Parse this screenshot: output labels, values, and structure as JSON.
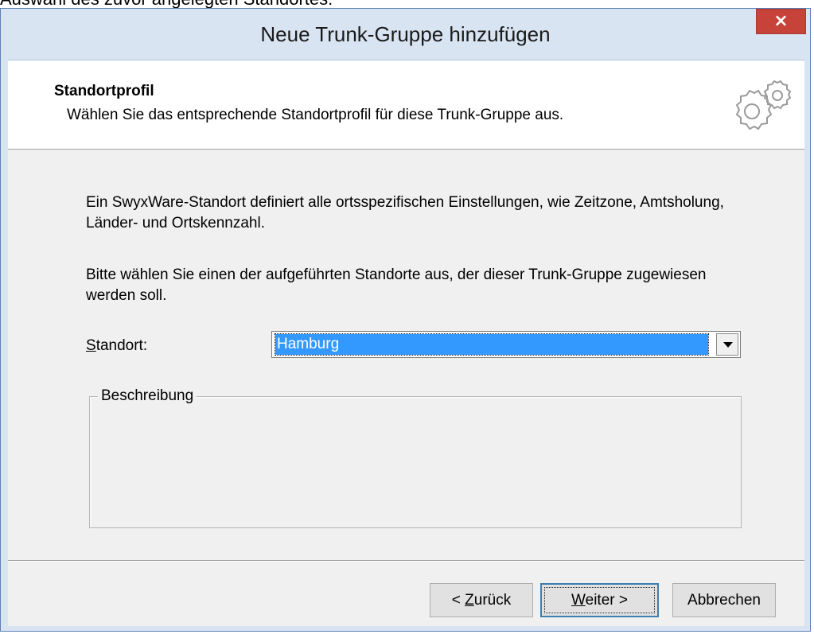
{
  "caption": "Auswahl des zuvor angelegten Standortes:",
  "window": {
    "title": "Neue Trunk-Gruppe hinzufügen",
    "close_glyph": "×"
  },
  "header": {
    "title": "Standortprofil",
    "subtitle": "Wählen Sie das entsprechende Standortprofil für diese Trunk-Gruppe aus.",
    "icon": "gears-icon"
  },
  "content": {
    "paragraph1": "Ein SwyxWare-Standort definiert alle ortsspezifischen Einstellungen, wie Zeitzone, Amtsholung, Länder- und Ortskennzahl.",
    "paragraph2": "Bitte wählen Sie einen der aufgeführten Standorte aus, der dieser Trunk-Gruppe zugewiesen werden soll.",
    "standort_label_mnemonic": "S",
    "standort_label_rest": "tandort:",
    "standort_value": "Hamburg",
    "description_legend": "Beschreibung"
  },
  "buttons": {
    "back_prefix": "< ",
    "back_mnemonic": "Z",
    "back_rest": "urück",
    "next_mnemonic": "W",
    "next_rest": "eiter >",
    "cancel": "Abbrechen"
  },
  "colors": {
    "selection": "#3399ff",
    "close_button": "#c7433a",
    "window_frame": "#d9e4f2"
  }
}
